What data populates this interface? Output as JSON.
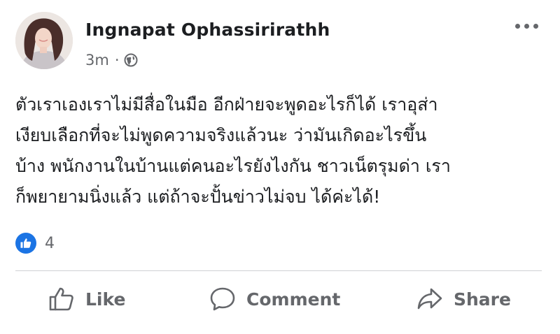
{
  "post": {
    "author": "Ingnapat Ophassirirathh",
    "time": "3m",
    "separator": "·",
    "privacy_icon": "globe-icon",
    "more_icon": "more-options-icon",
    "text_lines": [
      "ตัวเราเองเราไม่มีสื่อในมือ อีกฝ่ายจะพูดอะไรก็ได้ เราอุส่า",
      "เงียบเลือกที่จะไม่พูดความจริงแล้วนะ ว่ามันเกิดอะไรขึ้น",
      "บ้าง พนักงานในบ้านแต่คนอะไรยังไงกัน ชาวเน็ตรุมด่า เรา",
      "ก็พยายามนิ่งแล้ว แต่ถ้าจะปั้นข่าวไม่จบ ได้ค่ะได้!"
    ]
  },
  "reactions": {
    "icon": "like-reaction-icon",
    "count": "4"
  },
  "actions": {
    "like": "Like",
    "comment": "Comment",
    "share": "Share"
  },
  "colors": {
    "text": "#1c1e21",
    "secondary": "#65676b",
    "like_blue": "#1b74e4",
    "divider": "#ced0d4"
  }
}
